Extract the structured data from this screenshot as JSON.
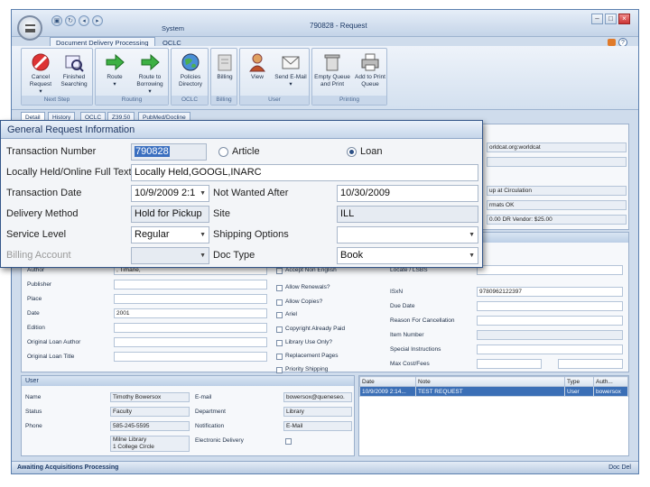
{
  "window": {
    "system_label": "System",
    "title": "790828 - Request",
    "help_icon": "?"
  },
  "ribbon": {
    "tabs": [
      "Document Delivery Processing",
      "OCLC"
    ],
    "groups": [
      {
        "label": "Next Step",
        "buttons": [
          {
            "label": "Cancel Request",
            "icon": "cancel-icon",
            "sub": "▾"
          },
          {
            "label": "Finished Searching",
            "icon": "finished-searching-icon",
            "sub": ""
          }
        ]
      },
      {
        "label": "Routing",
        "buttons": [
          {
            "label": "Route",
            "icon": "route-arrow-icon",
            "sub": "▾"
          },
          {
            "label": "Route to Borrowing",
            "icon": "route-borrowing-icon",
            "sub": "▾"
          }
        ]
      },
      {
        "label": "OCLC",
        "buttons": [
          {
            "label": "Policies Directory",
            "icon": "globe-icon",
            "sub": ""
          }
        ]
      },
      {
        "label": "Billing",
        "buttons": [
          {
            "label": "Billing",
            "icon": "billing-icon",
            "sub": ""
          }
        ]
      },
      {
        "label": "User",
        "buttons": [
          {
            "label": "View",
            "icon": "user-icon",
            "sub": ""
          },
          {
            "label": "Send E-Mail",
            "icon": "email-icon",
            "sub": "▾"
          }
        ]
      },
      {
        "label": "Printing",
        "buttons": [
          {
            "label": "Empty Queue and Print",
            "icon": "trash-icon",
            "sub": ""
          },
          {
            "label": "Add to Print Queue",
            "icon": "print-icon",
            "sub": ""
          }
        ]
      }
    ]
  },
  "doc_tabs": [
    "Detail",
    "History",
    "OCLC",
    "Z39.50",
    "PubMed/Docline"
  ],
  "general": {
    "header": "General Request Information",
    "transaction_number_label": "Transaction Number",
    "transaction_number": "790828",
    "radio_article": "Article",
    "radio_loan": "Loan",
    "radio_selected": "Loan",
    "full_text_label": "Locally Held/Online Full Text",
    "full_text": "Locally Held,GOOGL,INARC",
    "transaction_date_label": "Transaction Date",
    "transaction_date": "10/9/2009 2:1",
    "not_wanted_after_label": "Not Wanted After",
    "not_wanted_after": "10/30/2009",
    "delivery_method_label": "Delivery Method",
    "delivery_method": "Hold for Pickup",
    "site_label": "Site",
    "site": "ILL",
    "service_level_label": "Service Level",
    "service_level": "Regular",
    "shipping_options_label": "Shipping Options",
    "shipping_options": "",
    "billing_account_label": "Billing Account",
    "billing_account": "",
    "doc_type_label": "Doc Type",
    "doc_type": "Book"
  },
  "right_bg": {
    "lines": [
      "orldcat.org:worldcat",
      "",
      "up at Circulation",
      "rmats OK",
      "0.00 DR Vendor: $25.00"
    ]
  },
  "item": {
    "left_labels": [
      "Author",
      "Publisher",
      "Place",
      "Date",
      "Edition",
      "Original Loan Author",
      "Original Loan Title"
    ],
    "left_values": [
      ", Timarie,",
      "",
      "",
      "2001",
      "",
      "",
      ""
    ],
    "checkbox_labels": [
      "Accept Non English",
      "Allow Renewals?",
      "Allow Copies?",
      "Ariel",
      "Copyright Already Paid",
      "Library Use Only?",
      "Replacement Pages",
      "Priority Shipping"
    ],
    "right_labels": [
      "Locate / LSBS",
      "ISxN",
      "Due Date",
      "Reason For Cancellation",
      "Item Number",
      "Special Instructions",
      "Max Cost/Fees"
    ],
    "right_values": [
      "",
      "9780962122397",
      "",
      "",
      "",
      "",
      ""
    ]
  },
  "user": {
    "header": "User",
    "rows": [
      {
        "l1": "Name",
        "v1": "Timothy Bowersox",
        "l2": "E-mail",
        "v2": "bowersox@queneseo."
      },
      {
        "l1": "Status",
        "v1": "Faculty",
        "l2": "Department",
        "v2": "Library"
      },
      {
        "l1": "Phone",
        "v1": "585-245-5595",
        "l2": "Notification",
        "v2": "E-Mail"
      },
      {
        "l1": "",
        "v1": "Milne Library",
        "l2": "Electronic Delivery",
        "v2": ""
      }
    ],
    "address_line2": "1 College Circle"
  },
  "notes": {
    "columns": [
      "Date",
      "Note",
      "Type",
      "Auth..."
    ],
    "rows": [
      {
        "date": "10/9/2009 2:14...",
        "note": "TEST REQUEST",
        "type": "User",
        "author": "bowersox"
      }
    ]
  },
  "status": {
    "text": "Awaiting Acquisitions Processing",
    "right_label": "Doc Del"
  }
}
